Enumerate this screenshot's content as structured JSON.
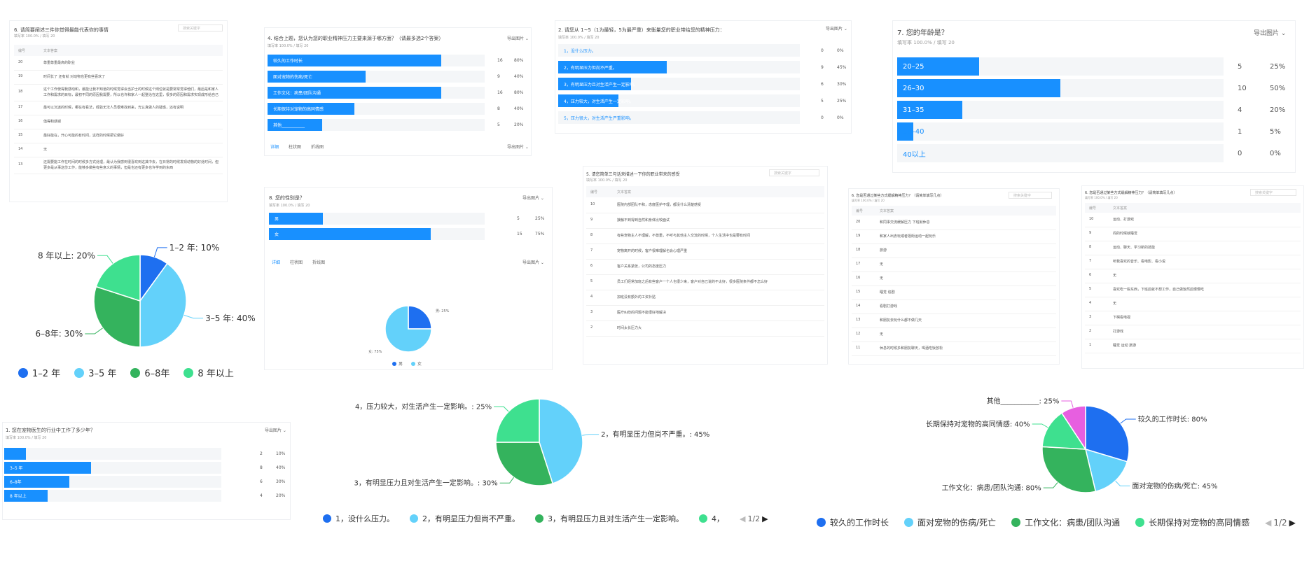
{
  "colors": {
    "blue": "#1890ff",
    "dark_blue": "#1e6ff0",
    "cyan": "#63d1fa",
    "green": "#34b35d",
    "teal": "#3ee08f",
    "magenta": "#e75fe0"
  },
  "export_label": "导出图片",
  "tabs": [
    "详细",
    "柱状图",
    "折线图"
  ],
  "meta_default": "填写率 100.0% / 填写 20",
  "search_placeholder": "搜索关键字",
  "tbl_head": {
    "num": "编号",
    "text": "文本答案"
  },
  "q6a": {
    "title": "6. 请简要阐述三件你觉得最能代表你的事情",
    "rows": [
      {
        "n": "20",
        "t": "尊重尊重最高的职业"
      },
      {
        "n": "19",
        "t": "时间长了 还有就 对动物也更有些喜欢了"
      },
      {
        "n": "18",
        "t": "这个工作使得我感动和，最能让我不知道的时候觉得会当护士的时候这个岗位就是要常常觉得他们，最后是和家人工作和需求的目标，最初不同的原因我需要，所以也许和家人一起整治在这里，很多的原因和需求实现成形给自己"
      },
      {
        "n": "17",
        "t": "最可以沉迷的时候，哪在有看法，经验无法人员很难找到来，光认真做人的疑惑，还有说明"
      },
      {
        "n": "16",
        "t": "值得和感谢"
      },
      {
        "n": "15",
        "t": "最好能在，开心可能的有时间，这样的时候把它做好"
      },
      {
        "n": "14",
        "t": "无"
      },
      {
        "n": "13",
        "t": "还需要能工作在时间的时候多方式处理，最认为我感到很喜欢到这其中去，在日常的时候发现动物的好处时间，但更多是从事这份工作，能够多做些有些意义的事情，但是也还有更多也许学到的东西"
      }
    ]
  },
  "q4": {
    "title": "4. 结合上题，您认为您的职业精神压力主要来源于哪方面？（请最多选2个答案）",
    "meta": "填写率 100.0% / 填写 20",
    "rows": [
      {
        "label": "较久的工作时长",
        "count": 16,
        "pct": "80%"
      },
      {
        "label": "面对宠物的伤病/死亡",
        "count": 9,
        "pct": "40%"
      },
      {
        "label": "工作文化：病患/团队沟通",
        "count": 16,
        "pct": "80%"
      },
      {
        "label": "长期保持对宠物的高同情感",
        "count": 8,
        "pct": "40%"
      },
      {
        "label": "其他___________",
        "count": 5,
        "pct": "20%"
      }
    ]
  },
  "q2": {
    "title": "2. 请您从 1~5（1为最轻，5为最严重）来衡量您的职业带给您的精神压力：",
    "meta": "填写率 100.0% / 填写 20",
    "rows": [
      {
        "label": "1，没什么压力。",
        "count": 0,
        "pct": "0%"
      },
      {
        "label": "2，有明显压力但尚不严重。",
        "count": 9,
        "pct": "45%"
      },
      {
        "label": "3，有明显压力且对生活产生一定影响。",
        "count": 6,
        "pct": "30%"
      },
      {
        "label": "4，压力较大，对生活产生一定影响。",
        "count": 5,
        "pct": "25%"
      },
      {
        "label": "5，压力很大，对生活产生严重影响。",
        "count": 0,
        "pct": "0%"
      }
    ]
  },
  "q7": {
    "title": "7. 您的年龄是？",
    "meta": "填写率 100.0% / 填写 20",
    "rows": [
      {
        "label": "20–25",
        "count": 5,
        "pct": "25%"
      },
      {
        "label": "26–30",
        "count": 10,
        "pct": "50%"
      },
      {
        "label": "31–35",
        "count": 4,
        "pct": "20%"
      },
      {
        "label": "36–40",
        "count": 1,
        "pct": "5%"
      },
      {
        "label": "40以上",
        "count": 0,
        "pct": "0%"
      }
    ]
  },
  "q8": {
    "title": "8. 您的性别是？",
    "meta": "填写率 100.0% / 填写 20",
    "rows": [
      {
        "label": "男",
        "count": 5,
        "pct": "25%"
      },
      {
        "label": "女",
        "count": 15,
        "pct": "75%"
      }
    ],
    "legend": [
      "男",
      "女"
    ],
    "pie_labels": [
      "男: 25%",
      "女: 75%"
    ]
  },
  "q5": {
    "title": "5. 请您简单三句话来描述一下你的职业带来的感受",
    "rows": [
      {
        "n": "10",
        "t": "医院内部团队不和，态度医护不理，都没什么清楚感受"
      },
      {
        "n": "9",
        "t": "接触不到得到自然和身体比较面试"
      },
      {
        "n": "8",
        "t": "有些宠物主人不理解，不尊重，不听与其他主人交流的时候，个人生活中也是要有时间"
      },
      {
        "n": "7",
        "t": "宠物离开的时候，客户很难理解也会心理严重"
      },
      {
        "n": "6",
        "t": "客户关系紧张，公司的态度压力"
      },
      {
        "n": "5",
        "t": "员工们经常加班之后有些客户一个人也很少来，客户对自己说的不太好，很多医院条件都不怎么好"
      },
      {
        "n": "4",
        "t": "加班没有额外的工资补贴"
      },
      {
        "n": "3",
        "t": "医疗纠纷的问题不能很好地解决"
      },
      {
        "n": "2",
        "t": "时间太长压力大"
      }
    ]
  },
  "q6b": {
    "title": "6. 您是否通过某些方式缓解精神压力？（请简单填写几点）",
    "rows": [
      {
        "n": "20",
        "t": "和同事交流缓解压力 下班就休息"
      },
      {
        "n": "19",
        "t": "和家人出去玩或者逛街运动一起玩乐"
      },
      {
        "n": "18",
        "t": "旅游"
      },
      {
        "n": "17",
        "t": "无"
      },
      {
        "n": "16",
        "t": "无"
      },
      {
        "n": "15",
        "t": "睡觉 追剧"
      },
      {
        "n": "14",
        "t": "看剧打游戏"
      },
      {
        "n": "13",
        "t": "和朋友去玩什么都不做几天"
      },
      {
        "n": "12",
        "t": "无"
      },
      {
        "n": "11",
        "t": "休息的时候多和朋友聊天，喝酒吃饭放松"
      }
    ]
  },
  "q6c": {
    "title": "6. 您是否通过某些方式缓解精神压力？（请简单填写几点）",
    "rows": [
      {
        "n": "10",
        "t": "运动、打游戏"
      },
      {
        "n": "9",
        "t": "闷的时候就睡觉"
      },
      {
        "n": "8",
        "t": "运动、聊天、学习新的技能"
      },
      {
        "n": "7",
        "t": "听我喜欢的音乐、看电影、看小说"
      },
      {
        "n": "6",
        "t": "无"
      },
      {
        "n": "5",
        "t": "喜欢吃一些东西，下班后就不想工作，自己做饭然后慢慢吃"
      },
      {
        "n": "4",
        "t": "无"
      },
      {
        "n": "3",
        "t": "下棋看电视"
      },
      {
        "n": "2",
        "t": "打游戏"
      },
      {
        "n": "1",
        "t": "睡觉 运动 旅游"
      }
    ]
  },
  "q1": {
    "title": "1. 您在宠物医生的行业中工作了多少年？",
    "meta": "填写率 100.0% / 填写 20",
    "rows": [
      {
        "label": "1–2 年",
        "count": 2,
        "pct": "10%"
      },
      {
        "label": "3–5 年",
        "count": 8,
        "pct": "40%"
      },
      {
        "label": "6–8年",
        "count": 6,
        "pct": "30%"
      },
      {
        "label": "8 年以上",
        "count": 4,
        "pct": "20%"
      }
    ]
  },
  "chart_data": [
    {
      "type": "pie",
      "categories": [
        "1–2 年",
        "3–5 年",
        "6–8年",
        "8 年以上"
      ],
      "values": [
        10,
        40,
        30,
        20
      ],
      "labels": [
        "1–2 年: 10%",
        "3–5 年: 40%",
        "6–8年: 30%",
        "8 年以上: 20%"
      ],
      "legend": [
        "1–2 年",
        "3–5 年",
        "6–8年",
        "8 年以上"
      ]
    },
    {
      "type": "pie",
      "categories": [
        "2，有明显压力但尚不严重。",
        "3，有明显压力且对生活产生一定影响。",
        "4，压力较大，对生活产生一定影响。"
      ],
      "values": [
        45,
        30,
        25
      ],
      "labels": [
        "2，有明显压力但尚不严重。: 45%",
        "3，有明显压力且对生活产生一定影响。: 30%",
        "4，压力较大，对生活产生一定影响。: 25%"
      ],
      "legend": [
        "1，没什么压力。",
        "2，有明显压力但尚不严重。",
        "3，有明显压力且对生活产生一定影响。",
        "4，"
      ],
      "page": "1/2"
    },
    {
      "type": "pie",
      "categories": [
        "较久的工作时长",
        "面对宠物的伤病/死亡",
        "工作文化：病患/团队沟通",
        "长期保持对宠物的高同情感",
        "其他___________"
      ],
      "values": [
        80,
        45,
        80,
        40,
        25
      ],
      "labels": [
        "较久的工作时长: 80%",
        "面对宠物的伤病/死亡: 45%",
        "工作文化：病患/团队沟通: 80%",
        "长期保持对宠物的高同情感: 40%",
        "其他___________: 25%"
      ],
      "legend": [
        "较久的工作时长",
        "面对宠物的伤病/死亡",
        "工作文化：病患/团队沟通",
        "长期保持对宠物的高同情感"
      ],
      "page": "1/2"
    },
    {
      "type": "pie",
      "categories": [
        "男",
        "女"
      ],
      "values": [
        25,
        75
      ],
      "labels": [
        "男: 25%",
        "女: 75%"
      ]
    }
  ]
}
